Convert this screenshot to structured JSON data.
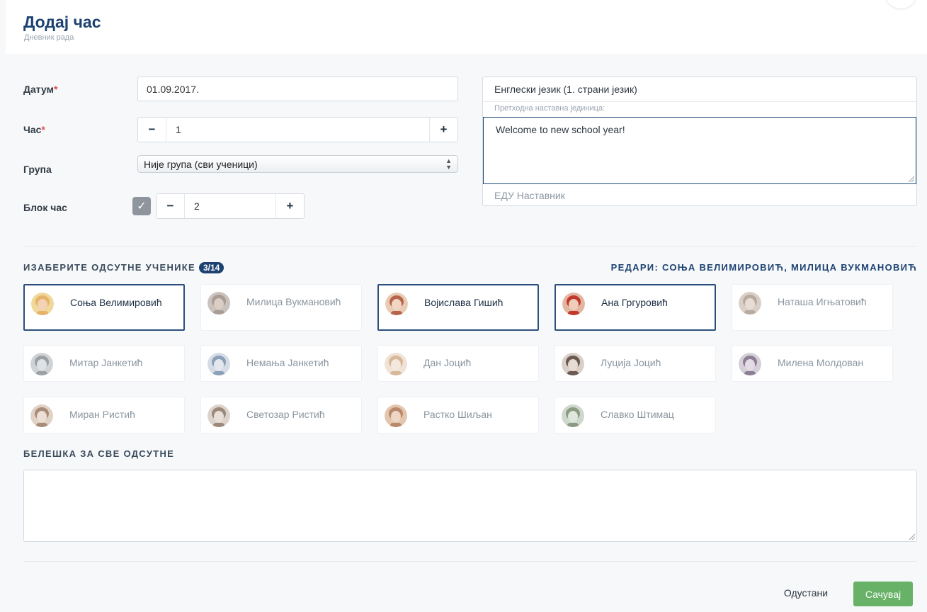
{
  "header": {
    "title": "Додај час",
    "subtitle": "Дневник рада"
  },
  "form": {
    "date_label": "Датум",
    "date_value": "01.09.2017.",
    "hour_label": "Час",
    "hour_value": "1",
    "group_label": "Група",
    "group_value": "Није група (сви ученици)",
    "block_label": "Блок час",
    "block_checked": true,
    "block_value": "2",
    "required_mark": "*",
    "minus": "−",
    "plus": "+"
  },
  "lesson": {
    "subject": "Енглески језик (1. страни језик)",
    "previous_label": "Претходна наставна јединица:",
    "previous_value": "Welcome to new school year!",
    "teacher": "ЕДУ Наставник"
  },
  "absent": {
    "title": "ИЗАБЕРИТЕ ОДСУТНЕ УЧЕНИКЕ",
    "count": "3/14",
    "duty": "РЕДАРИ: СОЊА ВЕЛИМИРОВИЋ, МИЛИЦА ВУКМАНОВИЋ",
    "students": [
      {
        "name": "Соња Велимировић",
        "selected": true
      },
      {
        "name": "Милица Вукмановић",
        "selected": false
      },
      {
        "name": "Војислава Гишић",
        "selected": true
      },
      {
        "name": "Ана Гргуровић",
        "selected": true
      },
      {
        "name": "Наташа Игњатовић",
        "selected": false
      },
      {
        "name": "Митар Јанкетић",
        "selected": false
      },
      {
        "name": "Немања Јанкетић",
        "selected": false
      },
      {
        "name": "Дан Јоцић",
        "selected": false
      },
      {
        "name": "Луција Јоцић",
        "selected": false
      },
      {
        "name": "Милена Молдован",
        "selected": false
      },
      {
        "name": "Миран Ристић",
        "selected": false
      },
      {
        "name": "Светозар Ристић",
        "selected": false
      },
      {
        "name": "Растко Шиљан",
        "selected": false
      },
      {
        "name": "Славко Штимац",
        "selected": false
      }
    ]
  },
  "note": {
    "title": "БЕЛЕШКА ЗА СВЕ ОДСУТНЕ",
    "value": ""
  },
  "actions": {
    "cancel": "Одустани",
    "save": "Сачувај"
  },
  "colors": {
    "primary": "#1d4271",
    "success": "#67b266",
    "required": "#e24b4b"
  }
}
